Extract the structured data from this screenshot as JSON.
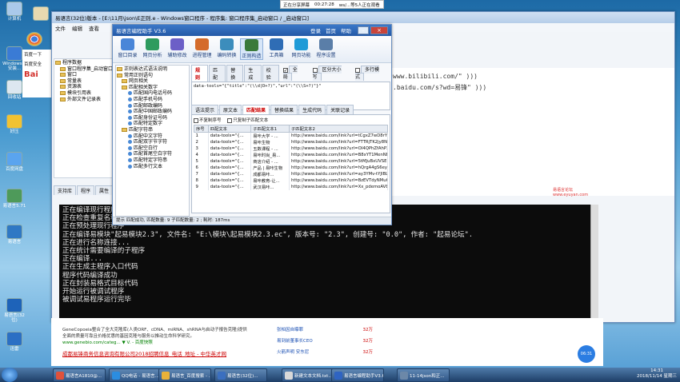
{
  "notification": {
    "text1": "正在分享屏幕",
    "time": "00:27:28",
    "text2": "ws/...等5人正在观看"
  },
  "watermark": {
    "line1": "易语言论坛",
    "line2": "www.eyuyan.com"
  },
  "desktop_icons": [
    {
      "label": "计算机"
    },
    {
      "label": "Windows 7 安装..."
    },
    {
      "label": "回收站"
    },
    {
      "label": "好压"
    },
    {
      "label": "百度网盘"
    },
    {
      "label": "易语言5.71"
    },
    {
      "label": "易语言"
    },
    {
      "label": "易语言(32位)"
    },
    {
      "label": "迅雷"
    },
    {
      "label": "hybird"
    }
  ],
  "ide": {
    "title": "易语言(32位)版本 - [E:\\11月\\json\\E正则.e - Windows窗口程序 - 程序集: 窗口程序集_启动窗口 / _启动窗口]",
    "menu": [
      "文件",
      "编辑",
      "查看",
      "插入",
      "数据库",
      "运行",
      "程序",
      "调试",
      "工具",
      "窗口",
      "帮助"
    ],
    "tree_root": "程序数据",
    "tree": [
      {
        "t": "窗口程序集_启动窗口",
        "lvl": 1,
        "k": "f"
      },
      {
        "t": "窗口",
        "lvl": 1,
        "k": "f"
      },
      {
        "t": "常量表",
        "lvl": 1,
        "k": "f"
      },
      {
        "t": "资源表",
        "lvl": 1,
        "k": "f"
      },
      {
        "t": "模块引用表",
        "lvl": 1,
        "k": "f"
      },
      {
        "t": "外部文件记录表",
        "lvl": 1,
        "k": "f"
      }
    ],
    "left_tabs": [
      "支持库",
      "程序",
      "属性"
    ],
    "side_left": {
      "item1": "百度一下",
      "item2": "百度安全"
    }
  },
  "helper": {
    "title": "易语言编程助手 V3.6",
    "top_links": [
      "登录",
      "首页",
      "帮助"
    ],
    "toolbar": [
      "窗口目录",
      "网页分析",
      "辅助修改",
      "进程管理",
      "编码转换",
      "正则构造",
      "工具箱",
      "网页功能",
      "程序设置"
    ],
    "tree": [
      {
        "t": "正则表达式语法说明",
        "lvl": 0,
        "k": "f"
      },
      {
        "t": "常用正则语句",
        "lvl": 0,
        "k": "f"
      },
      {
        "t": "网页相关",
        "lvl": 1,
        "k": "f"
      },
      {
        "t": "匹配相关数字",
        "lvl": 1,
        "k": "f"
      },
      {
        "t": "匹配国内电话号码",
        "lvl": 2,
        "k": "l"
      },
      {
        "t": "匹配手机号码",
        "lvl": 2,
        "k": "l"
      },
      {
        "t": "匹配邮政编码",
        "lvl": 2,
        "k": "l"
      },
      {
        "t": "匹配中国邮政编码",
        "lvl": 2,
        "k": "l"
      },
      {
        "t": "匹配身份证号码",
        "lvl": 2,
        "k": "l"
      },
      {
        "t": "匹配特定数字",
        "lvl": 2,
        "k": "l"
      },
      {
        "t": "匹配字符串",
        "lvl": 1,
        "k": "f"
      },
      {
        "t": "匹配中文字符",
        "lvl": 2,
        "k": "l"
      },
      {
        "t": "匹配双字节字符",
        "lvl": 2,
        "k": "l"
      },
      {
        "t": "匹配空白行",
        "lvl": 2,
        "k": "l"
      },
      {
        "t": "匹配首尾空白字符",
        "lvl": 2,
        "k": "l"
      },
      {
        "t": "匹配特定字符串",
        "lvl": 2,
        "k": "l"
      },
      {
        "t": "匹配多行文本",
        "lvl": 2,
        "k": "l"
      }
    ],
    "upper_tabs": [
      "规则",
      "匹配",
      "替换",
      "生成",
      "校验"
    ],
    "options": {
      "global": "全局",
      "case": "区分大小写",
      "multiline": "多行模式"
    },
    "pattern": "data-tools=\"{\"title\":\"(\\\\d|D+?)\",\"url\":\"(\\\\S+?)\"}\"",
    "lower_tabs": [
      "语法提示",
      "原文本",
      "匹配结果",
      "替换结果",
      "生成代码",
      "关联记录"
    ],
    "lower_opts": {
      "a": "不复制序号",
      "b": "只复制子匹配文本"
    },
    "columns": [
      "序号",
      "匹配文本",
      "子匹配文本1",
      "子匹配文本2"
    ],
    "rows": [
      [
        "1",
        "data-tools=\"{...",
        "易咔大学 - ...",
        "http://www.baidu.com/link?url=tCgxZ7wD8rYFP..."
      ],
      [
        "2",
        "data-tools=\"{...",
        "易咔生物",
        "http://www.baidu.com/link?url=FTTRjTK2jy8N8Bhuo..."
      ],
      [
        "3",
        "data-tools=\"{...",
        "五数课程 - ...",
        "http://www.baidu.com/link?url=OI4QPhZfAhP2_rypq..."
      ],
      [
        "4",
        "data-tools=\"{...",
        "易咔时尚_易...",
        "http://www.baidu.com/link?url=B8xYT1MenNEXDXP47..."
      ],
      [
        "5",
        "data-tools=\"{...",
        "商店介绍 - ...",
        "http://www.baidu.com/link?url=5tMJuBxUVSEKXIxZc..."
      ],
      [
        "6",
        "data-tools=\"{...",
        "产品 | 易咔生物",
        "http://www.baidu.com/link?url=hQrgA4gS6eyR2t2SNI..."
      ],
      [
        "7",
        "data-tools=\"{...",
        "成都易咔...",
        "http://www.baidu.com/link?url=ay3YMv-tYJIBLiNWPW..."
      ],
      [
        "8",
        "data-tools=\"{...",
        "易咔教育-让...",
        "http://www.baidu.com/link?url=BzEVTdyNMu6KwvOiNWS..."
      ],
      [
        "9",
        "data-tools=\"{...",
        "武汉易咔...",
        "http://www.baidu.com/link?url=Xx_pdemoAV8hAaM9U..."
      ]
    ],
    "status": "提示  匹配成功, 匹配数量: 9  子匹配数量: 2 ; 耗时: 187ms"
  },
  "behind_text": {
    "line1": "www.bilibili.com/\" )))",
    "line2": ".baidu.com/s?wd=易锋\" )))"
  },
  "console_lines": [
    "正在编译现行程序",
    "正在检查重复名称...",
    "正在预处理现行程序",
    "正在编译易模块\"起易模块2.3\", 文件名: \"E:\\模块\\起易模块2.3.ec\", 版本号: \"2.3\", 创建号: \"0.0\", 作者: \"起易论坛\".",
    "正在进行名称连接...",
    "正在统计需要编译的子程序",
    "正在编译...",
    "正在生成主程序入口代码",
    "程序代码编译成功",
    "正在封装易格式目标代码",
    "开始运行被调试程序",
    "被调试易程序运行完毕"
  ],
  "browser": {
    "ad_text": "GeneCopoeia整合了全大克隆库(人类ORF、cDNA、miRNA、shRNA与启动子报告克隆)提供",
    "ad_text2": "全面的质量可靠且价格优惠的基因克隆与服务以推动生命科学研究。",
    "url": "www.genebio.com/categ...  ▼  V.  - 百度快照",
    "ad_link": "成都易锋商务信息咨询有限公司2018招聘信息_电话_地址 - 中华英才网",
    "hot": [
      {
        "t": "张柏因自曝罪",
        "n": "32万"
      },
      {
        "t": "易到前董事长CEO",
        "n": "32万"
      },
      {
        "t": "火箭声明 安东尼",
        "n": "32万"
      }
    ]
  },
  "taskbar": {
    "items": [
      "易语言A1810@...",
      "QQ电话 - 易语言...",
      "易语言_百度搜索 - ...",
      "易语言(32位)...",
      "新建文本文档.txt...",
      "易语言编程助手V3.6",
      "11-14json和正..."
    ],
    "time": "14:31",
    "date": "2018/11/14 星期三"
  },
  "clock_badge": "06:31"
}
